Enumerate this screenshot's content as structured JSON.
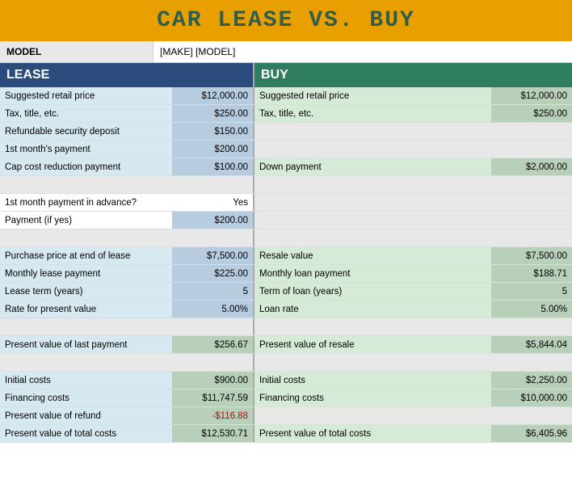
{
  "title": "CAR LEASE VS. BUY",
  "model": {
    "label": "MODEL",
    "value": "[MAKE] [MODEL]"
  },
  "lease": {
    "header": "LEASE",
    "rows": [
      {
        "label": "Suggested retail price",
        "value": "$12,000.00",
        "labelBg": "bg-light-blue",
        "valueBg": "bg-blue-value"
      },
      {
        "label": "Tax, title, etc.",
        "value": "$250.00",
        "labelBg": "bg-light-blue",
        "valueBg": "bg-blue-value"
      },
      {
        "label": "Refundable security deposit",
        "value": "$150.00",
        "labelBg": "bg-light-blue",
        "valueBg": "bg-blue-value"
      },
      {
        "label": "1st month's payment",
        "value": "$200.00",
        "labelBg": "bg-light-blue",
        "valueBg": "bg-blue-value"
      },
      {
        "label": "Cap cost reduction payment",
        "value": "$100.00",
        "labelBg": "bg-light-blue",
        "valueBg": "bg-blue-value"
      },
      {
        "label": "",
        "value": "",
        "labelBg": "bg-empty",
        "valueBg": "bg-empty",
        "empty": true
      },
      {
        "label": "1st month payment in advance?",
        "value": "Yes",
        "labelBg": "bg-white",
        "valueBg": "bg-white"
      },
      {
        "label": "Payment (if yes)",
        "value": "$200.00",
        "labelBg": "bg-white",
        "valueBg": "bg-blue-value"
      },
      {
        "label": "",
        "value": "",
        "labelBg": "bg-empty",
        "valueBg": "bg-empty",
        "empty": true
      },
      {
        "label": "Purchase price at end of lease",
        "value": "$7,500.00",
        "labelBg": "bg-light-blue",
        "valueBg": "bg-blue-value"
      },
      {
        "label": "Monthly lease payment",
        "value": "$225.00",
        "labelBg": "bg-light-blue",
        "valueBg": "bg-blue-value"
      },
      {
        "label": "Lease term (years)",
        "value": "5",
        "labelBg": "bg-light-blue",
        "valueBg": "bg-blue-value"
      },
      {
        "label": "Rate for present value",
        "value": "5.00%",
        "labelBg": "bg-light-blue",
        "valueBg": "bg-blue-value"
      },
      {
        "label": "",
        "value": "",
        "labelBg": "bg-empty",
        "valueBg": "bg-empty",
        "empty": true
      },
      {
        "label": "Present value of last payment",
        "value": "$256.67",
        "labelBg": "bg-light-blue",
        "valueBg": "bg-dark-value"
      },
      {
        "label": "",
        "value": "",
        "labelBg": "bg-empty",
        "valueBg": "bg-empty",
        "empty": true
      },
      {
        "label": "Initial costs",
        "value": "$900.00",
        "labelBg": "bg-light-blue",
        "valueBg": "bg-dark-value"
      },
      {
        "label": "Financing costs",
        "value": "$11,747.59",
        "labelBg": "bg-light-blue",
        "valueBg": "bg-dark-value"
      },
      {
        "label": "Present value of refund",
        "value": "-$116.88",
        "labelBg": "bg-light-blue",
        "valueBg": "bg-dark-value",
        "negative": true
      },
      {
        "label": "Present value of total costs",
        "value": "$12,530.71",
        "labelBg": "bg-light-blue",
        "valueBg": "bg-dark-value"
      }
    ]
  },
  "buy": {
    "header": "BUY",
    "rows": [
      {
        "label": "Suggested retail price",
        "value": "$12,000.00",
        "labelBg": "bg-light-green",
        "valueBg": "bg-dark-value"
      },
      {
        "label": "Tax, title, etc.",
        "value": "$250.00",
        "labelBg": "bg-light-green",
        "valueBg": "bg-dark-value"
      },
      {
        "label": "",
        "value": "",
        "labelBg": "bg-empty",
        "valueBg": "bg-empty",
        "empty": true
      },
      {
        "label": "",
        "value": "",
        "labelBg": "bg-empty",
        "valueBg": "bg-empty",
        "empty": true
      },
      {
        "label": "Down payment",
        "value": "$2,000.00",
        "labelBg": "bg-light-green",
        "valueBg": "bg-dark-value"
      },
      {
        "label": "",
        "value": "",
        "labelBg": "bg-empty",
        "valueBg": "bg-empty",
        "empty": true
      },
      {
        "label": "",
        "value": "",
        "labelBg": "bg-empty",
        "valueBg": "bg-empty",
        "empty": true
      },
      {
        "label": "",
        "value": "",
        "labelBg": "bg-empty",
        "valueBg": "bg-empty",
        "empty": true
      },
      {
        "label": "",
        "value": "",
        "labelBg": "bg-empty",
        "valueBg": "bg-empty",
        "empty": true
      },
      {
        "label": "Resale value",
        "value": "$7,500.00",
        "labelBg": "bg-light-green",
        "valueBg": "bg-dark-value"
      },
      {
        "label": "Monthly loan payment",
        "value": "$188.71",
        "labelBg": "bg-light-green",
        "valueBg": "bg-dark-value"
      },
      {
        "label": "Term of loan (years)",
        "value": "5",
        "labelBg": "bg-light-green",
        "valueBg": "bg-dark-value"
      },
      {
        "label": "Loan rate",
        "value": "5.00%",
        "labelBg": "bg-light-green",
        "valueBg": "bg-dark-value"
      },
      {
        "label": "",
        "value": "",
        "labelBg": "bg-empty",
        "valueBg": "bg-empty",
        "empty": true
      },
      {
        "label": "Present value of resale",
        "value": "$5,844.04",
        "labelBg": "bg-light-green",
        "valueBg": "bg-dark-value"
      },
      {
        "label": "",
        "value": "",
        "labelBg": "bg-empty",
        "valueBg": "bg-empty",
        "empty": true
      },
      {
        "label": "Initial costs",
        "value": "$2,250.00",
        "labelBg": "bg-light-green",
        "valueBg": "bg-dark-value"
      },
      {
        "label": "Financing costs",
        "value": "$10,000.00",
        "labelBg": "bg-light-green",
        "valueBg": "bg-dark-value"
      },
      {
        "label": "",
        "value": "",
        "labelBg": "bg-empty",
        "valueBg": "bg-empty",
        "empty": true
      },
      {
        "label": "Present value of total costs",
        "value": "$6,405.96",
        "labelBg": "bg-light-green",
        "valueBg": "bg-dark-value"
      }
    ]
  }
}
